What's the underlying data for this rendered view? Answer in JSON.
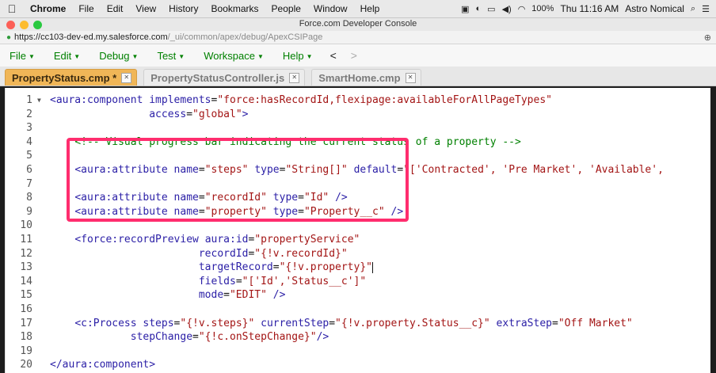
{
  "menubar": {
    "app_name": "Chrome",
    "items": [
      "File",
      "Edit",
      "View",
      "History",
      "Bookmarks",
      "People",
      "Window",
      "Help"
    ],
    "battery": "100%",
    "clock": "Thu 11:16 AM",
    "user": "Astro Nomical"
  },
  "window": {
    "title": "Force.com Developer Console"
  },
  "address_bar": {
    "host": "https://cc103-dev-ed.my.salesforce.com",
    "path": "/_ui/common/apex/debug/ApexCSIPage"
  },
  "console_menu": {
    "items": [
      "File",
      "Edit",
      "Debug",
      "Test",
      "Workspace",
      "Help"
    ],
    "back": "<",
    "forward": ">"
  },
  "tabs": [
    {
      "label": "PropertyStatus.cmp *"
    },
    {
      "label": "PropertyStatusController.js"
    },
    {
      "label": "SmartHome.cmp"
    }
  ],
  "editor": {
    "lines": [
      {
        "n": "1",
        "fold": "▼",
        "tokens": [
          [
            "tg",
            "<aura:component "
          ],
          [
            "at",
            "implements"
          ],
          [
            "pn",
            "="
          ],
          [
            "st",
            "\"force:hasRecordId,flexipage:availableForAllPageTypes\""
          ]
        ]
      },
      {
        "n": "2",
        "tokens": [
          [
            "pn",
            "                "
          ],
          [
            "at",
            "access"
          ],
          [
            "pn",
            "="
          ],
          [
            "st",
            "\"global\""
          ],
          [
            "tg",
            ">"
          ]
        ]
      },
      {
        "n": "3",
        "tokens": []
      },
      {
        "n": "4",
        "tokens": [
          [
            "pn",
            "    "
          ],
          [
            "cm",
            "<!-- Visual progress bar indicating the current status of a property -->"
          ]
        ]
      },
      {
        "n": "5",
        "tokens": []
      },
      {
        "n": "6",
        "tokens": [
          [
            "pn",
            "    "
          ],
          [
            "tg",
            "<aura:attribute "
          ],
          [
            "at",
            "name"
          ],
          [
            "pn",
            "="
          ],
          [
            "st",
            "\"steps\""
          ],
          [
            "pn",
            " "
          ],
          [
            "at",
            "type"
          ],
          [
            "pn",
            "="
          ],
          [
            "st",
            "\"String[]\""
          ],
          [
            "pn",
            " "
          ],
          [
            "at",
            "default"
          ],
          [
            "pn",
            "="
          ],
          [
            "st",
            "\"['Contracted', 'Pre Market', 'Available',"
          ]
        ]
      },
      {
        "n": "7",
        "tokens": []
      },
      {
        "n": "8",
        "tokens": [
          [
            "pn",
            "    "
          ],
          [
            "tg",
            "<aura:attribute "
          ],
          [
            "at",
            "name"
          ],
          [
            "pn",
            "="
          ],
          [
            "st",
            "\"recordId\""
          ],
          [
            "pn",
            " "
          ],
          [
            "at",
            "type"
          ],
          [
            "pn",
            "="
          ],
          [
            "st",
            "\"Id\""
          ],
          [
            "pn",
            " "
          ],
          [
            "tg",
            "/>"
          ]
        ]
      },
      {
        "n": "9",
        "tokens": [
          [
            "pn",
            "    "
          ],
          [
            "tg",
            "<aura:attribute "
          ],
          [
            "at",
            "name"
          ],
          [
            "pn",
            "="
          ],
          [
            "st",
            "\"property\""
          ],
          [
            "pn",
            " "
          ],
          [
            "at",
            "type"
          ],
          [
            "pn",
            "="
          ],
          [
            "st",
            "\"Property__c\""
          ],
          [
            "pn",
            " "
          ],
          [
            "tg",
            "/>"
          ]
        ]
      },
      {
        "n": "10",
        "tokens": []
      },
      {
        "n": "11",
        "tokens": [
          [
            "pn",
            "    "
          ],
          [
            "tg",
            "<force:recordPreview "
          ],
          [
            "at",
            "aura:id"
          ],
          [
            "pn",
            "="
          ],
          [
            "st",
            "\"propertyService\""
          ]
        ]
      },
      {
        "n": "12",
        "tokens": [
          [
            "pn",
            "                        "
          ],
          [
            "at",
            "recordId"
          ],
          [
            "pn",
            "="
          ],
          [
            "st",
            "\"{!v.recordId}\""
          ]
        ]
      },
      {
        "n": "13",
        "tokens": [
          [
            "pn",
            "                        "
          ],
          [
            "at",
            "targetRecord"
          ],
          [
            "pn",
            "="
          ],
          [
            "st",
            "\"{!v.property}\""
          ]
        ],
        "cursor": true
      },
      {
        "n": "14",
        "tokens": [
          [
            "pn",
            "                        "
          ],
          [
            "at",
            "fields"
          ],
          [
            "pn",
            "="
          ],
          [
            "st",
            "\"['Id','Status__c']\""
          ]
        ]
      },
      {
        "n": "15",
        "tokens": [
          [
            "pn",
            "                        "
          ],
          [
            "at",
            "mode"
          ],
          [
            "pn",
            "="
          ],
          [
            "st",
            "\"EDIT\""
          ],
          [
            "pn",
            " "
          ],
          [
            "tg",
            "/>"
          ]
        ]
      },
      {
        "n": "16",
        "tokens": []
      },
      {
        "n": "17",
        "tokens": [
          [
            "pn",
            "    "
          ],
          [
            "tg",
            "<c:Process "
          ],
          [
            "at",
            "steps"
          ],
          [
            "pn",
            "="
          ],
          [
            "st",
            "\"{!v.steps}\""
          ],
          [
            "pn",
            " "
          ],
          [
            "at",
            "currentStep"
          ],
          [
            "pn",
            "="
          ],
          [
            "st",
            "\"{!v.property.Status__c}\""
          ],
          [
            "pn",
            " "
          ],
          [
            "at",
            "extraStep"
          ],
          [
            "pn",
            "="
          ],
          [
            "st",
            "\"Off Market\""
          ]
        ]
      },
      {
        "n": "18",
        "tokens": [
          [
            "pn",
            "             "
          ],
          [
            "at",
            "stepChange"
          ],
          [
            "pn",
            "="
          ],
          [
            "st",
            "\"{!c.onStepChange}\""
          ],
          [
            "tg",
            "/>"
          ]
        ]
      },
      {
        "n": "19",
        "tokens": []
      },
      {
        "n": "20",
        "tokens": [
          [
            "tg",
            "</aura:component>"
          ]
        ]
      }
    ]
  },
  "colors": {
    "active_tab": "#f0b657",
    "highlight_box": "#ff2d6e",
    "tag": "#2a1ea6",
    "string": "#a31515",
    "comment": "#008000"
  }
}
